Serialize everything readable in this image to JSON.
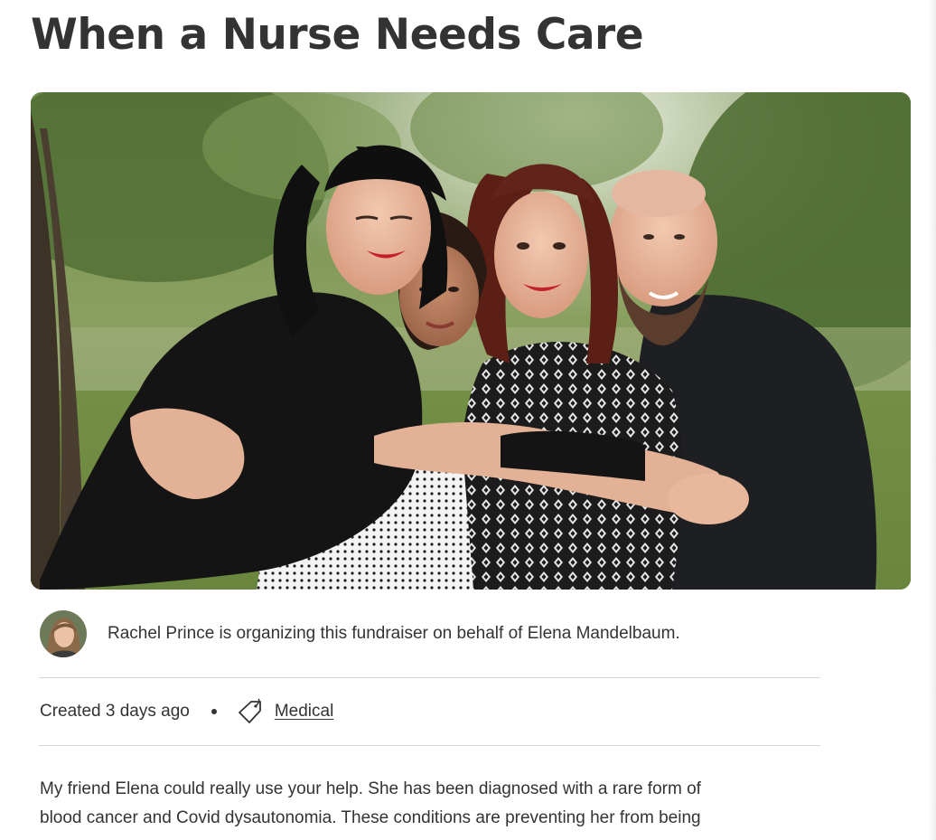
{
  "campaign": {
    "title": "When a Nurse Needs Care"
  },
  "hero_image": {
    "icon": "fundraiser-photo"
  },
  "organizer": {
    "avatar_icon": "organizer-avatar",
    "text": "Rachel Prince is organizing this fundraiser on behalf of Elena Mandelbaum."
  },
  "meta": {
    "created": "Created 3 days ago",
    "tag_icon": "tag-icon",
    "category": "Medical"
  },
  "story": {
    "lines": [
      "My friend Elena could really use your help. She has been diagnosed with a rare form of",
      "blood cancer and Covid dysautonomia. These conditions are preventing her from being"
    ]
  },
  "colors": {
    "text": "#333333",
    "divider": "#d6d6d6",
    "background": "#ffffff"
  }
}
